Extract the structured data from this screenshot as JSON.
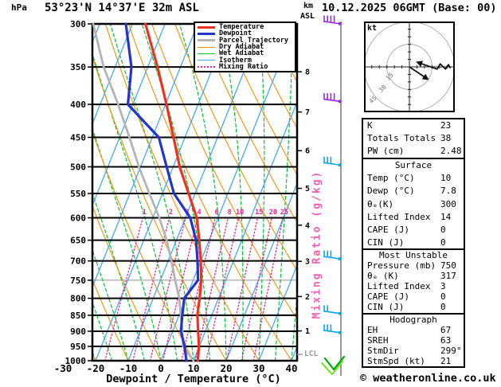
{
  "header": {
    "pressure_unit": "hPa",
    "station_title": "53°23'N 14°37'E 32m ASL",
    "run_title": "10.12.2025 06GMT (Base: 00)",
    "altitude_unit_top": "km",
    "altitude_unit_bottom": "ASL"
  },
  "footer": {
    "credit": "© weatheronline.co.uk"
  },
  "axes": {
    "pressure_ticks": [
      300,
      350,
      400,
      450,
      500,
      550,
      600,
      650,
      700,
      750,
      800,
      850,
      900,
      950,
      1000
    ],
    "temperature_ticks": [
      -30,
      -20,
      -10,
      0,
      10,
      20,
      30,
      40
    ],
    "x_axis_title": "Dewpoint / Temperature (°C)",
    "km_ticks": [
      {
        "km": 1,
        "hpa": 899
      },
      {
        "km": 2,
        "hpa": 795
      },
      {
        "km": 3,
        "hpa": 701
      },
      {
        "km": 4,
        "hpa": 616
      },
      {
        "km": 5,
        "hpa": 540
      },
      {
        "km": 6,
        "hpa": 472
      },
      {
        "km": 7,
        "hpa": 411
      },
      {
        "km": 8,
        "hpa": 356
      }
    ],
    "lcl_label": "LCL",
    "mixing_axis_title": "Mixing Ratio (g/kg)"
  },
  "colors": {
    "temperature": "#f0311f",
    "dewpoint": "#2334cc",
    "parcel": "#b4b4b4",
    "dry_adiabat": "#ff8c00",
    "wet_adiabat": "#00c832",
    "isotherm": "#3fa8ff",
    "mixing_ratio": "#f02090",
    "grid": "#000000",
    "grid_750": "#909090",
    "wind_staff": "#777777",
    "lcl": "#999999",
    "hodo_ring": "#b0b0b0",
    "hodo_ring_label": "#999999",
    "surface_wind_dark": "#00aa00",
    "surface_wind_light": "#7be030"
  },
  "chart_data": {
    "type": "line",
    "subtype": "skew-t-log-p-sounding",
    "x_unit": "°C",
    "y_unit": "hPa",
    "pressure_range": [
      300,
      1000
    ],
    "temperature_range_at_surface": [
      -21,
      42
    ],
    "mixing_ratio_lines_g_kg": [
      1,
      2,
      3,
      4,
      6,
      8,
      10,
      15,
      20,
      25
    ],
    "series": [
      {
        "name": "Temperature",
        "points": [
          [
            300,
            -46
          ],
          [
            350,
            -37
          ],
          [
            400,
            -29.7
          ],
          [
            450,
            -23.5
          ],
          [
            500,
            -18
          ],
          [
            550,
            -12
          ],
          [
            600,
            -6.5
          ],
          [
            650,
            -3
          ],
          [
            700,
            0
          ],
          [
            750,
            2.5
          ],
          [
            800,
            4.2
          ],
          [
            850,
            5.6
          ],
          [
            900,
            7.8
          ],
          [
            950,
            9.9
          ],
          [
            1000,
            11.3
          ]
        ]
      },
      {
        "name": "Dewpoint",
        "points": [
          [
            300,
            -52
          ],
          [
            350,
            -45
          ],
          [
            400,
            -41.5
          ],
          [
            450,
            -28
          ],
          [
            500,
            -22
          ],
          [
            550,
            -16.5
          ],
          [
            600,
            -8.5
          ],
          [
            650,
            -4
          ],
          [
            700,
            -1
          ],
          [
            750,
            1.5
          ],
          [
            800,
            -0.5
          ],
          [
            850,
            1
          ],
          [
            900,
            2.5
          ],
          [
            950,
            5.5
          ],
          [
            1000,
            7.8
          ]
        ]
      },
      {
        "name": "Parcel Trajectory",
        "points": [
          [
            300,
            -62
          ],
          [
            350,
            -53.5
          ],
          [
            400,
            -44.5
          ],
          [
            450,
            -37
          ],
          [
            500,
            -30.5
          ],
          [
            550,
            -24
          ],
          [
            600,
            -18
          ],
          [
            650,
            -13
          ],
          [
            700,
            -9
          ],
          [
            750,
            -5.5
          ],
          [
            800,
            -2
          ],
          [
            850,
            0.5
          ],
          [
            900,
            3
          ],
          [
            950,
            5
          ],
          [
            1000,
            10
          ]
        ]
      }
    ],
    "wind_barbs": [
      {
        "hpa": 300,
        "color": "#a020f0",
        "feathers": 4
      },
      {
        "hpa": 396,
        "color": "#a020f0",
        "feathers": 4
      },
      {
        "hpa": 497,
        "color": "#00a6f0",
        "feathers": 3
      },
      {
        "hpa": 695,
        "color": "#00a6f0",
        "feathers": 3
      },
      {
        "hpa": 845,
        "color": "#00a6f0",
        "feathers": 2
      },
      {
        "hpa": 905,
        "color": "#00a6f0",
        "feathers": 3
      }
    ]
  },
  "legend": {
    "items": [
      {
        "label": "Temperature",
        "color": "#f0311f",
        "style": "solid",
        "weight": 3
      },
      {
        "label": "Dewpoint",
        "color": "#2334cc",
        "style": "solid",
        "weight": 3
      },
      {
        "label": "Parcel Trajectory",
        "color": "#b4b4b4",
        "style": "solid",
        "weight": 3
      },
      {
        "label": "Dry Adiabat",
        "color": "#ff8c00",
        "style": "solid",
        "weight": 1
      },
      {
        "label": "Wet Adiabat",
        "color": "#00c832",
        "style": "solid",
        "weight": 1
      },
      {
        "label": "Isotherm",
        "color": "#3fa8ff",
        "style": "solid",
        "weight": 1
      },
      {
        "label": "Mixing Ratio",
        "color": "#f02090",
        "style": "dotted",
        "weight": 2
      }
    ]
  },
  "hodograph": {
    "unit_label": "kt",
    "rings_kt": [
      15,
      30,
      45
    ],
    "tick_step_kt": 5,
    "trace_kt": [
      [
        27,
        -0.5
      ],
      [
        26,
        1.5
      ],
      [
        24,
        -1.5
      ],
      [
        20.5,
        2
      ],
      [
        18.5,
        -1.5
      ],
      [
        5.5,
        3
      ]
    ],
    "storm_motion_kt": [
      12,
      -8
    ]
  },
  "panels": [
    {
      "sections": [
        {
          "header": null,
          "rows": [
            {
              "label": "K",
              "value": "23"
            },
            {
              "label": "Totals Totals",
              "value": "38"
            },
            {
              "label": "PW (cm)",
              "value": "2.48"
            }
          ]
        },
        {
          "header": "Surface",
          "rows": [
            {
              "label": "Temp (°C)",
              "value": "10"
            },
            {
              "label": "Dewp (°C)",
              "value": "7.8"
            },
            {
              "label": "θₑ(K)",
              "value": "300"
            },
            {
              "label": "Lifted Index",
              "value": "14"
            },
            {
              "label": "CAPE (J)",
              "value": "0"
            },
            {
              "label": "CIN (J)",
              "value": "0"
            }
          ]
        }
      ]
    },
    {
      "sections": [
        {
          "header": "Most Unstable",
          "rows": [
            {
              "label": "Pressure (mb)",
              "value": "750"
            },
            {
              "label": "θₑ (K)",
              "value": "317"
            },
            {
              "label": "Lifted Index",
              "value": "3"
            },
            {
              "label": "CAPE (J)",
              "value": "0"
            },
            {
              "label": "CIN (J)",
              "value": "0"
            }
          ]
        },
        {
          "header": "Hodograph",
          "rows": [
            {
              "label": "EH",
              "value": "67"
            },
            {
              "label": "SREH",
              "value": "63"
            },
            {
              "label": "StmDir",
              "value": "299°"
            },
            {
              "label": "StmSpd (kt)",
              "value": "21"
            }
          ]
        }
      ]
    }
  ]
}
